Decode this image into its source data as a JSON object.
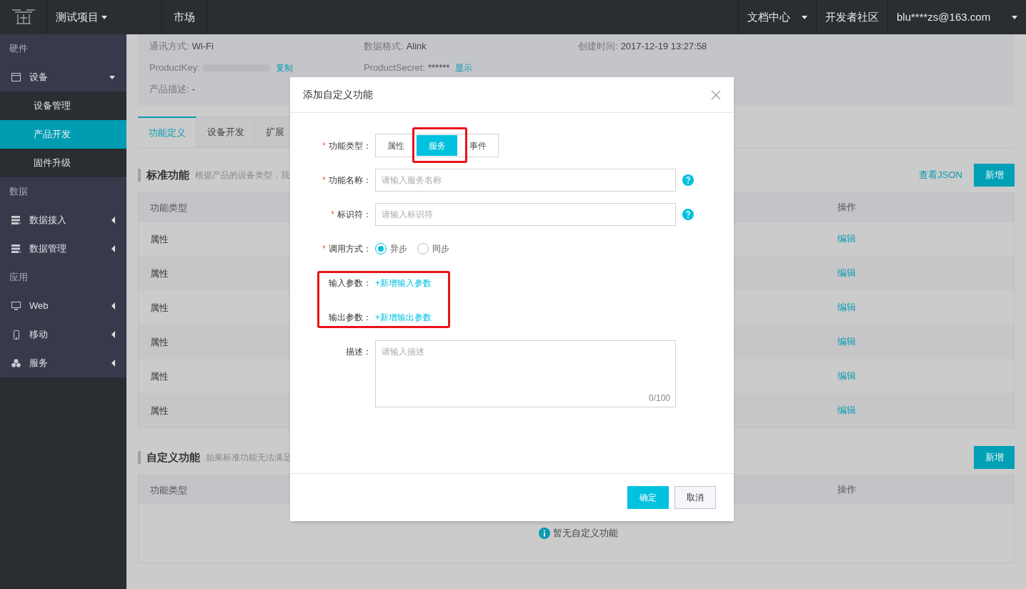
{
  "topbar": {
    "project": "测试项目",
    "nav": [
      "市场"
    ],
    "right": [
      {
        "label": "文档中心",
        "dropdown": true
      },
      {
        "label": "开发者社区",
        "dropdown": false
      },
      {
        "label": "blu****zs@163.com",
        "dropdown": true
      }
    ]
  },
  "sidebar": {
    "sections": [
      {
        "title": "硬件",
        "items": [
          {
            "label": "设备",
            "kind": "window",
            "expanded": true,
            "children": [
              {
                "label": "设备管理",
                "selected": false
              },
              {
                "label": "产品开发",
                "selected": true
              },
              {
                "label": "固件升级",
                "selected": false
              }
            ]
          }
        ]
      },
      {
        "title": "数据",
        "items": [
          {
            "label": "数据接入",
            "kind": "server",
            "expanded": false
          },
          {
            "label": "数据管理",
            "kind": "server",
            "expanded": false
          }
        ]
      },
      {
        "title": "应用",
        "items": [
          {
            "label": "Web",
            "kind": "monitor",
            "expanded": false
          },
          {
            "label": "移动",
            "kind": "phone",
            "expanded": false
          },
          {
            "label": "服务",
            "kind": "cluster",
            "expanded": false
          }
        ]
      }
    ]
  },
  "info": {
    "rows": [
      [
        {
          "label": "通讯方式:",
          "value": "Wi-Fi"
        },
        {
          "label": "数据格式:",
          "value": "Alink"
        },
        {
          "label": "创建时间:",
          "value": "2017-12-19 13:27:58"
        }
      ],
      [
        {
          "label": "ProductKey:",
          "redacted": true,
          "link": "复制"
        },
        {
          "label": "ProductSecret:",
          "value": "******",
          "link": "显示"
        }
      ],
      [
        {
          "label": "产品描述:",
          "value": "-"
        }
      ]
    ]
  },
  "tabs": [
    {
      "label": "功能定义",
      "selected": true
    },
    {
      "label": "设备开发",
      "selected": false
    },
    {
      "label": "扩展",
      "selected": false
    }
  ],
  "standard": {
    "title": "标准功能",
    "description": "根据产品的设备类型，我",
    "json_link": "查看JSON",
    "add_button": "新增",
    "columns": [
      "功能类型",
      "操作"
    ],
    "rows": [
      {
        "type": "属性",
        "action": "编辑"
      },
      {
        "type": "属性",
        "action": "编辑"
      },
      {
        "type": "属性",
        "action": "编辑"
      },
      {
        "type": "属性",
        "action": "编辑"
      },
      {
        "type": "属性",
        "action": "编辑"
      },
      {
        "type": "属性",
        "action": "编辑"
      }
    ]
  },
  "custom": {
    "title": "自定义功能",
    "description": "如果标准功能无法满足",
    "add_button": "新增",
    "columns": [
      "功能类型",
      "操作"
    ],
    "empty": "暂无自定义功能"
  },
  "dialog": {
    "title": "添加自定义功能",
    "fields": [
      {
        "kind": "segmented",
        "label": "功能类型：",
        "required_mark": "*",
        "options": [
          {
            "label": "属性",
            "selected": false
          },
          {
            "label": "服务",
            "selected": true
          },
          {
            "label": "事件",
            "selected": false
          }
        ]
      },
      {
        "kind": "input",
        "label": "功能名称：",
        "required_mark": "*",
        "placeholder": "请输入服务名称",
        "help": true
      },
      {
        "kind": "input",
        "label": "标识符：",
        "required_mark": "*",
        "placeholder": "请输入标识符",
        "help": true
      },
      {
        "kind": "radio",
        "label": "调用方式：",
        "required_mark": "*",
        "options": [
          {
            "label": "异步",
            "selected": true
          },
          {
            "label": "同步",
            "selected": false
          }
        ]
      },
      {
        "kind": "link",
        "label": "输入参数：",
        "link": "+新增输入参数"
      },
      {
        "kind": "link",
        "label": "输出参数：",
        "link": "+新增输出参数"
      },
      {
        "kind": "textarea",
        "label": "描述：",
        "placeholder": "请输入描述",
        "counter": "0/100"
      }
    ],
    "buttons": [
      {
        "label": "确定",
        "primary": true
      },
      {
        "label": "取消",
        "primary": false
      }
    ]
  }
}
